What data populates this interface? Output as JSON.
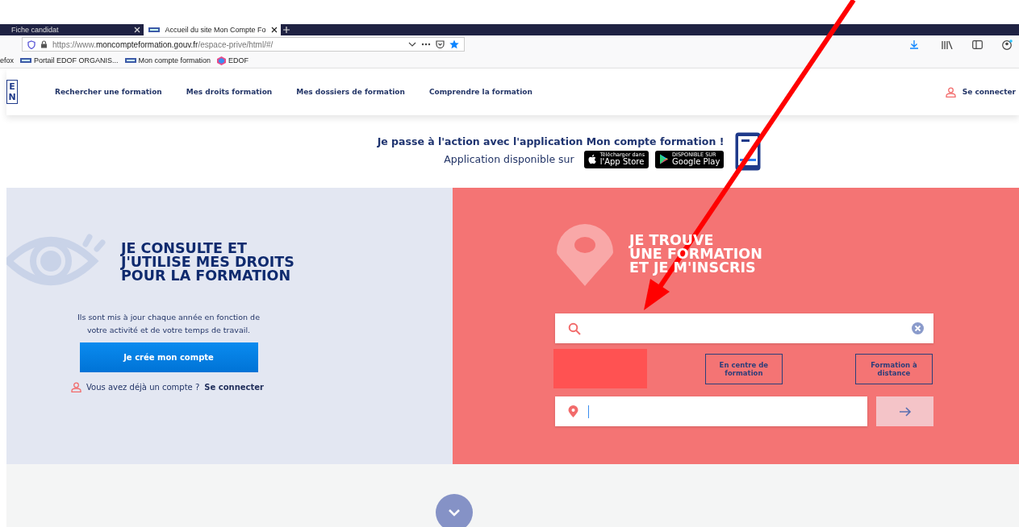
{
  "browser": {
    "tabs": [
      {
        "title": "Fiche candidat",
        "selected": false
      },
      {
        "title": "Accueil du site Mon Compte Fo",
        "selected": true
      }
    ],
    "url": {
      "host_prefix": "https://www.",
      "host": "moncompteformation.gouv.fr",
      "path": "/espace-prive/html/#/"
    },
    "bookmarks": [
      {
        "label": "efox",
        "kind": "text"
      },
      {
        "label": "Portail EDOF ORGANIS...",
        "kind": "site"
      },
      {
        "label": "Mon compte formation",
        "kind": "site"
      },
      {
        "label": "EDOF",
        "kind": "edof"
      }
    ]
  },
  "header": {
    "logo": [
      "E",
      "N"
    ],
    "nav": [
      "Rechercher une formation",
      "Mes droits formation",
      "Mes dossiers de formation",
      "Comprendre la formation"
    ],
    "login": "Se connecter"
  },
  "promo": {
    "title": "Je passe à l'action avec l'application Mon compte formation !",
    "subtitle": "Application disponible sur",
    "stores": [
      {
        "kind": "apple",
        "small": "Télécharger dans",
        "big": "l'App Store"
      },
      {
        "kind": "google",
        "small": "DISPONIBLE SUR",
        "big": "Google Play"
      }
    ]
  },
  "left_panel": {
    "title": [
      "JE CONSULTE ET",
      "J'UTILISE MES DROITS",
      "POUR LA FORMATION"
    ],
    "text": "Ils sont mis à jour chaque année en fonction de votre activité et de votre temps de travail.",
    "button": "Je crée mon compte",
    "account_question": "Vous avez déjà un compte ?",
    "login_link": "Se connecter"
  },
  "right_panel": {
    "title": [
      "JE TROUVE",
      "UNE FORMATION",
      "ET JE M'INSCRIS"
    ],
    "filters": [
      {
        "label": "En centre de formation"
      },
      {
        "label": "Formation à distance"
      }
    ]
  }
}
